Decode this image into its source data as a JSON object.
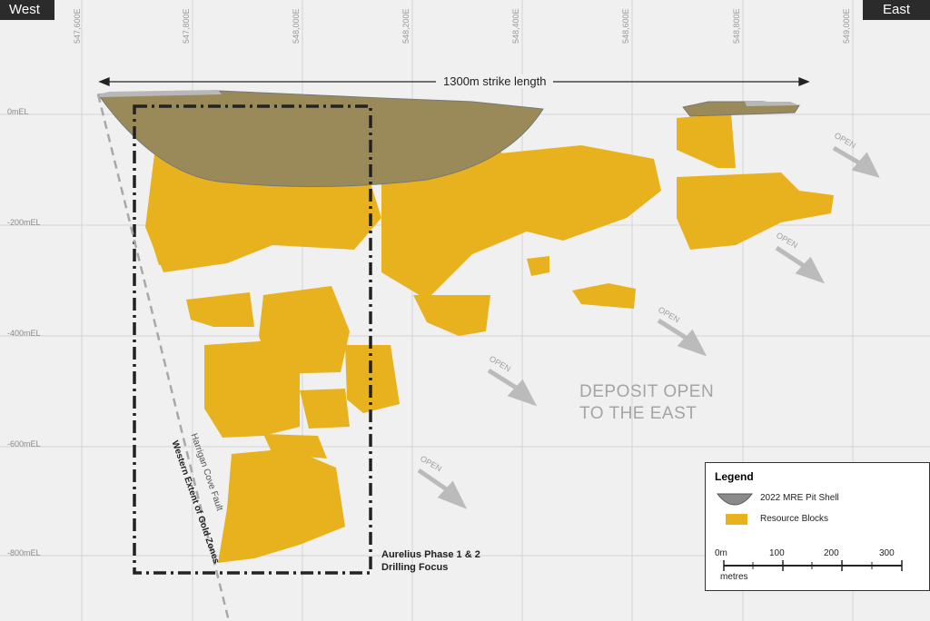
{
  "section": {
    "west_label": "West",
    "east_label": "East",
    "eastings": [
      "547,600E",
      "547,800E",
      "548,000E",
      "548,200E",
      "548,400E",
      "548,600E",
      "548,800E",
      "549,000E"
    ],
    "rls": [
      "0mEL",
      "-200mEL",
      "-400mEL",
      "-600mEL",
      "-800mEL"
    ],
    "strike_length": "1300m strike length",
    "focus_label": "Aurelius Phase 1 & 2\nDrilling Focus",
    "fault_name": "Harrigan Cove Fault",
    "fault_extent": "Western Extent of Gold Zones",
    "open_label": "OPEN",
    "deposit_open": "DEPOSIT OPEN\nTO THE EAST"
  },
  "legend": {
    "title": "Legend",
    "pit_shell": "2022 MRE Pit Shell",
    "resource_blocks": "Resource Blocks",
    "scale_values": [
      "0m",
      "100",
      "200",
      "300"
    ],
    "scale_unit": "metres"
  },
  "colors": {
    "resource": "#e8b21f",
    "pit_shell": "#9a9a9a",
    "background": "#f0f0f0",
    "corner": "#2b2b2b"
  },
  "icons": [
    "arrow-icon",
    "pit-shell-icon",
    "resource-block-icon"
  ]
}
